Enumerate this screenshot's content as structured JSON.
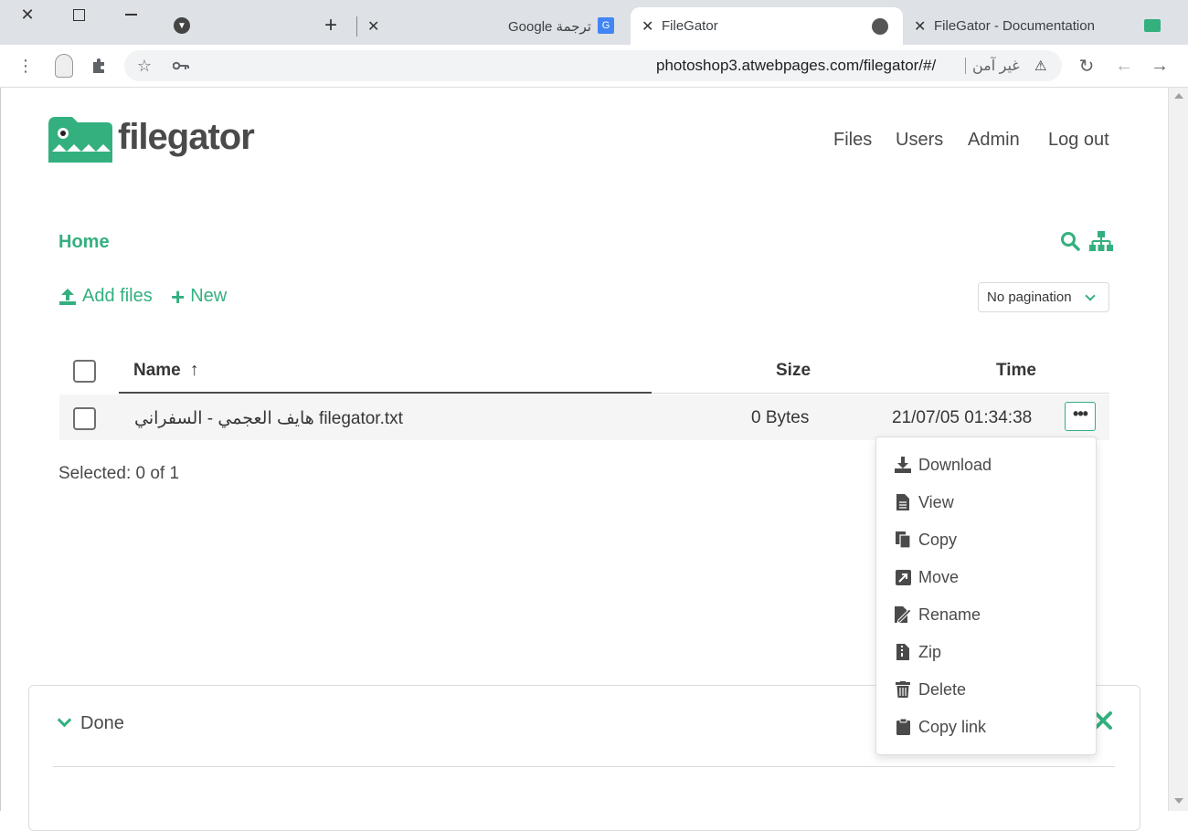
{
  "browser": {
    "tabs": [
      {
        "label": "ترجمة Google"
      },
      {
        "label": "FileGator"
      },
      {
        "label": "FileGator - Documentation"
      }
    ],
    "address": {
      "url": "photoshop3.atwebpages.com/filegator/#/",
      "security_label": "غير آمن"
    }
  },
  "app": {
    "logo_text": "filegator",
    "nav": {
      "files": "Files",
      "users": "Users",
      "admin": "Admin",
      "logout": "Log out"
    },
    "breadcrumb": {
      "home": "Home"
    },
    "actions": {
      "add_files": "Add files",
      "new": "New"
    },
    "pagination": {
      "selected": "No pagination"
    },
    "table": {
      "headers": {
        "name": "Name",
        "size": "Size",
        "time": "Time"
      },
      "rows": [
        {
          "name": "هايف العجمي - السفراني filegator.txt",
          "size": "0 Bytes",
          "time": "21/07/05 01:34:38"
        }
      ]
    },
    "selection_status": "Selected: 0 of 1",
    "context_menu": {
      "items": [
        {
          "label": "Download",
          "icon": "download-icon"
        },
        {
          "label": "View",
          "icon": "file-icon"
        },
        {
          "label": "Copy",
          "icon": "copy-icon"
        },
        {
          "label": "Move",
          "icon": "move-icon"
        },
        {
          "label": "Rename",
          "icon": "rename-icon"
        },
        {
          "label": "Zip",
          "icon": "zip-icon"
        },
        {
          "label": "Delete",
          "icon": "trash-icon"
        },
        {
          "label": "Copy link",
          "icon": "clipboard-icon"
        }
      ]
    },
    "upload_panel": {
      "title": "Done"
    }
  },
  "colors": {
    "accent": "#34b07f",
    "text": "#363636"
  }
}
